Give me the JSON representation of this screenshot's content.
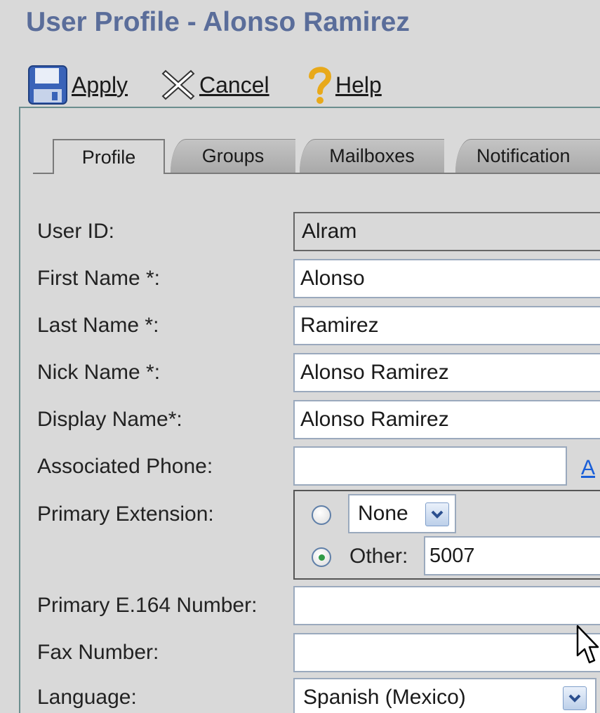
{
  "page": {
    "title": "User Profile - Alonso Ramirez"
  },
  "toolbar": {
    "apply_label": "Apply",
    "cancel_label": "Cancel",
    "help_label": "Help"
  },
  "tabs": [
    {
      "label": "Profile",
      "active": true
    },
    {
      "label": "Groups",
      "active": false
    },
    {
      "label": "Mailboxes",
      "active": false
    },
    {
      "label": "Notification",
      "active": false
    }
  ],
  "form": {
    "user_id": {
      "label": "User ID:",
      "value": "Alram"
    },
    "first_name": {
      "label": "First Name *:",
      "value": "Alonso"
    },
    "last_name": {
      "label": "Last Name *:",
      "value": "Ramirez"
    },
    "nick_name": {
      "label": "Nick Name *:",
      "value": "Alonso Ramirez"
    },
    "display_name": {
      "label": "Display Name*:",
      "value": "Alonso Ramirez"
    },
    "associated_phone": {
      "label": "Associated Phone:",
      "value": "",
      "link_text": "A"
    },
    "primary_extension": {
      "label": "Primary Extension:",
      "none_option": "None",
      "other_label": "Other:",
      "other_value": "5007",
      "selected": "other"
    },
    "primary_e164": {
      "label": "Primary E.164 Number:",
      "value": ""
    },
    "fax_number": {
      "label": "Fax Number:",
      "value": ""
    },
    "language": {
      "label": "Language:",
      "value": "Spanish (Mexico)"
    }
  },
  "icons": {
    "apply": "floppy-disk-icon",
    "cancel": "x-cross-icon",
    "help": "question-mark-icon",
    "dropdown": "chevron-down-icon",
    "cursor": "mouse-pointer-icon"
  },
  "colors": {
    "title": "#5a6d9a",
    "background": "#d9d9d9",
    "link": "#1a5fd8",
    "radio_checked": "#2f9a45"
  }
}
